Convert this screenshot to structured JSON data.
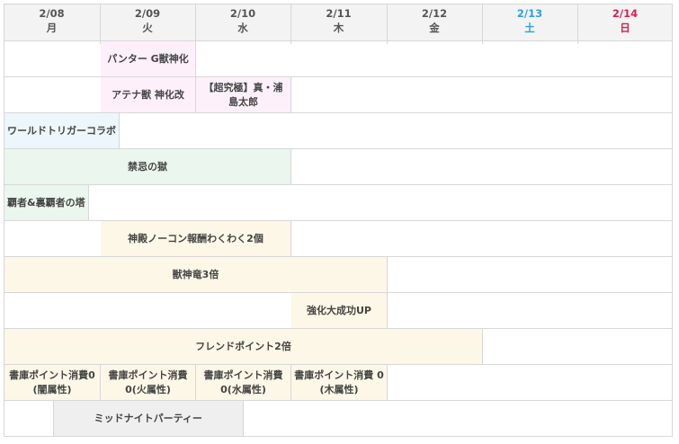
{
  "colors": {
    "saturday": "#2fa0d8",
    "sunday": "#d81f4f",
    "weekday": "#555555",
    "grid": "#d7d7d7"
  },
  "days": [
    {
      "date": "2/08",
      "weekday": "月",
      "kind": "weekday"
    },
    {
      "date": "2/09",
      "weekday": "火",
      "kind": "weekday"
    },
    {
      "date": "2/10",
      "weekday": "水",
      "kind": "weekday"
    },
    {
      "date": "2/11",
      "weekday": "木",
      "kind": "weekday"
    },
    {
      "date": "2/12",
      "weekday": "金",
      "kind": "weekday"
    },
    {
      "date": "2/13",
      "weekday": "土",
      "kind": "saturday"
    },
    {
      "date": "2/14",
      "weekday": "日",
      "kind": "sunday"
    }
  ],
  "events": [
    {
      "label": "パンター G獣神化",
      "row": 1,
      "start": 2,
      "end": 2,
      "color": "pink"
    },
    {
      "label": "アテナ獣 神化改",
      "row": 2,
      "start": 2,
      "end": 2,
      "color": "pink"
    },
    {
      "label": "【超究極】真・浦 島太郎",
      "row": 2,
      "start": 3,
      "end": 3,
      "color": "pink"
    },
    {
      "label": "ワールドトリガーコラボ",
      "row": 3,
      "start": 1,
      "end": 7,
      "color": "blue"
    },
    {
      "label": "禁忌の獄",
      "row": 4,
      "start": 1,
      "end": 3,
      "color": "green"
    },
    {
      "label": "覇者&裏覇者の塔",
      "row": 5,
      "start": 1,
      "end": 7,
      "color": "green"
    },
    {
      "label": "神殿ノーコン報酬わくわく2個",
      "row": 6,
      "start": 2,
      "end": 3,
      "color": "cream"
    },
    {
      "label": "獣神竜3倍",
      "row": 7,
      "start": 1,
      "end": 4,
      "color": "cream"
    },
    {
      "label": "強化大成功UP",
      "row": 8,
      "start": 4,
      "end": 4,
      "color": "cream"
    },
    {
      "label": "フレンドポイント2倍",
      "row": 9,
      "start": 1,
      "end": 5,
      "color": "cream"
    },
    {
      "label": "書庫ポイント消費0 (闇属性)",
      "row": 10,
      "start": 1,
      "end": 1,
      "color": "cream"
    },
    {
      "label": "書庫ポイント消費 0(火属性)",
      "row": 10,
      "start": 2,
      "end": 2,
      "color": "cream"
    },
    {
      "label": "書庫ポイント消費 0(水属性)",
      "row": 10,
      "start": 3,
      "end": 3,
      "color": "cream"
    },
    {
      "label": "書庫ポイント消費 0(木属性)",
      "row": 10,
      "start": 4,
      "end": 4,
      "color": "cream"
    },
    {
      "label": "ミッドナイトパーティー",
      "row": 11,
      "start": 1.5,
      "end": 2.5,
      "color": "gray"
    }
  ]
}
